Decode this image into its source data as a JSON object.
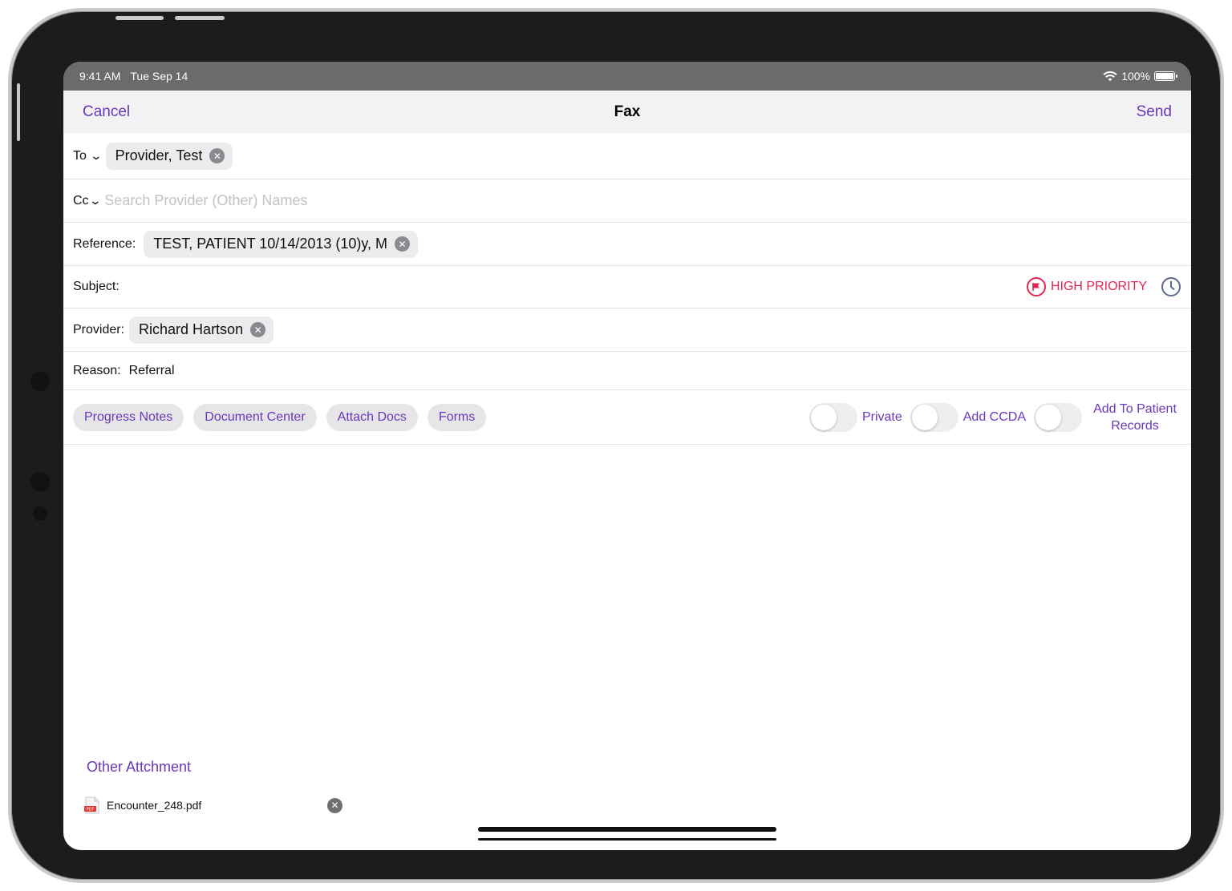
{
  "status": {
    "time": "9:41 AM",
    "date": "Tue Sep 14",
    "battery": "100%"
  },
  "nav": {
    "cancel": "Cancel",
    "title": "Fax",
    "send": "Send"
  },
  "to": {
    "label": "To",
    "chip": "Provider, Test"
  },
  "cc": {
    "label": "Cc",
    "placeholder": "Search Provider (Other) Names"
  },
  "reference": {
    "label": "Reference:",
    "chip": "TEST, PATIENT 10/14/2013 (10)y, M"
  },
  "subject": {
    "label": "Subject:",
    "priority": "HIGH PRIORITY"
  },
  "provider": {
    "label": "Provider:",
    "chip": "Richard Hartson"
  },
  "reason": {
    "label": "Reason:",
    "value": "Referral"
  },
  "actions": {
    "buttons": [
      "Progress Notes",
      "Document Center",
      "Attach Docs",
      "Forms"
    ],
    "toggles": [
      {
        "label": "Private",
        "on": false
      },
      {
        "label": "Add CCDA",
        "on": false
      },
      {
        "label": "Add To Patient Records",
        "on": false
      }
    ]
  },
  "attachments": {
    "title": "Other Attchment",
    "items": [
      {
        "name": "Encounter_248.pdf"
      }
    ]
  },
  "colors": {
    "accent": "#6a37b8",
    "priority": "#e0264f"
  }
}
